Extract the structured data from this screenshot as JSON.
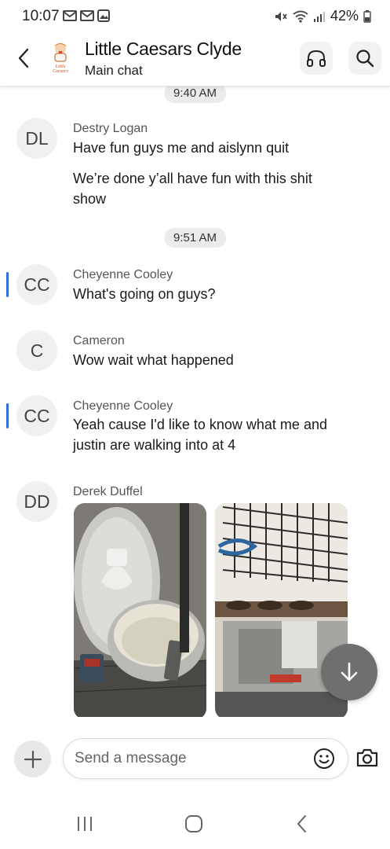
{
  "status_bar": {
    "time": "10:07",
    "battery": "42%"
  },
  "header": {
    "title": "Little Caesars Clyde",
    "subtitle": "Main chat",
    "logo_text": "Little Caesars"
  },
  "chat": {
    "time_pill_1": "9:40 AM",
    "time_pill_2": "9:51 AM",
    "messages": [
      {
        "initials": "DL",
        "sender": "Destry Logan",
        "lines": [
          "Have fun guys me and aislynn quit"
        ],
        "second": "We’re done y’all have fun with this shit show"
      },
      {
        "initials": "CC",
        "sender": "Cheyenne Cooley",
        "text": "What's going on guys?"
      },
      {
        "initials": "C",
        "sender": "Cameron",
        "text": "Wow wait what happened"
      },
      {
        "initials": "CC",
        "sender": "Cheyenne Cooley",
        "text": "Yeah cause I'd like to know what me and justin are walking into at 4"
      },
      {
        "initials": "DD",
        "sender": "Derek Duffel",
        "photos": [
          "food-processor-photo",
          "sink-rack-photo"
        ]
      }
    ]
  },
  "composer": {
    "placeholder": "Send a message"
  },
  "colors": {
    "accent_unread": "#2f6fd6",
    "avatar_bg": "#f0f0f0",
    "fab_bg": "#6f6f6f"
  },
  "icons": {
    "back": "chevron-left-icon",
    "headphones": "headphones-icon",
    "search": "search-icon",
    "plus": "plus-icon",
    "emoji": "emoji-icon",
    "camera": "camera-icon",
    "scroll_down": "arrow-down-icon"
  }
}
